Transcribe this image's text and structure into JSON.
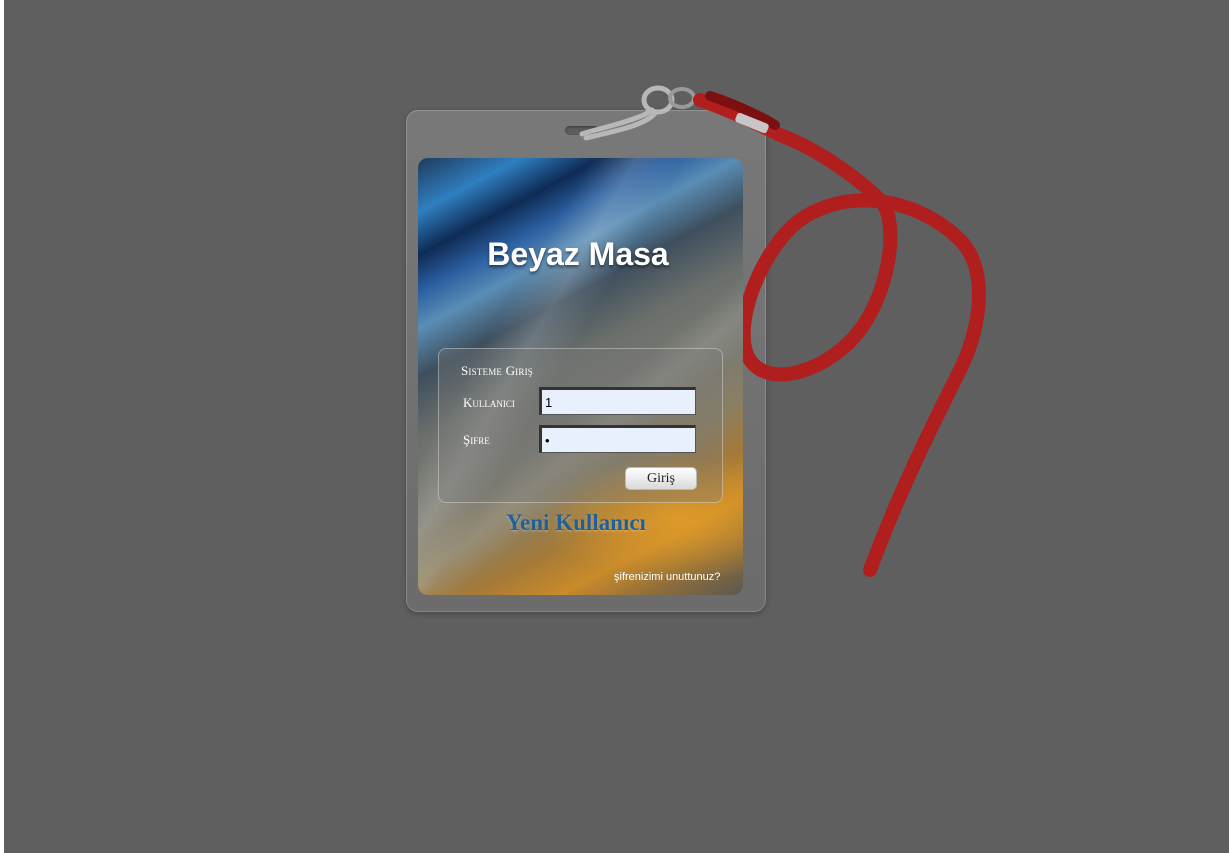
{
  "card": {
    "title": "Beyaz Masa"
  },
  "login": {
    "panel_title": "Sisteme Giriş",
    "username_label": "Kullanıcı",
    "username_value": "1",
    "password_label": "Şifre",
    "password_value": "1",
    "submit_label": "Giriş"
  },
  "links": {
    "new_user": "Yeni Kullanıcı",
    "forgot_password": "şifrenizimi unuttunuz?"
  },
  "colors": {
    "background": "#5f5f5f",
    "lanyard": "#b01e1e",
    "new_user_link": "#1f5f9a"
  },
  "icons": [
    "lanyard-clip-icon"
  ]
}
